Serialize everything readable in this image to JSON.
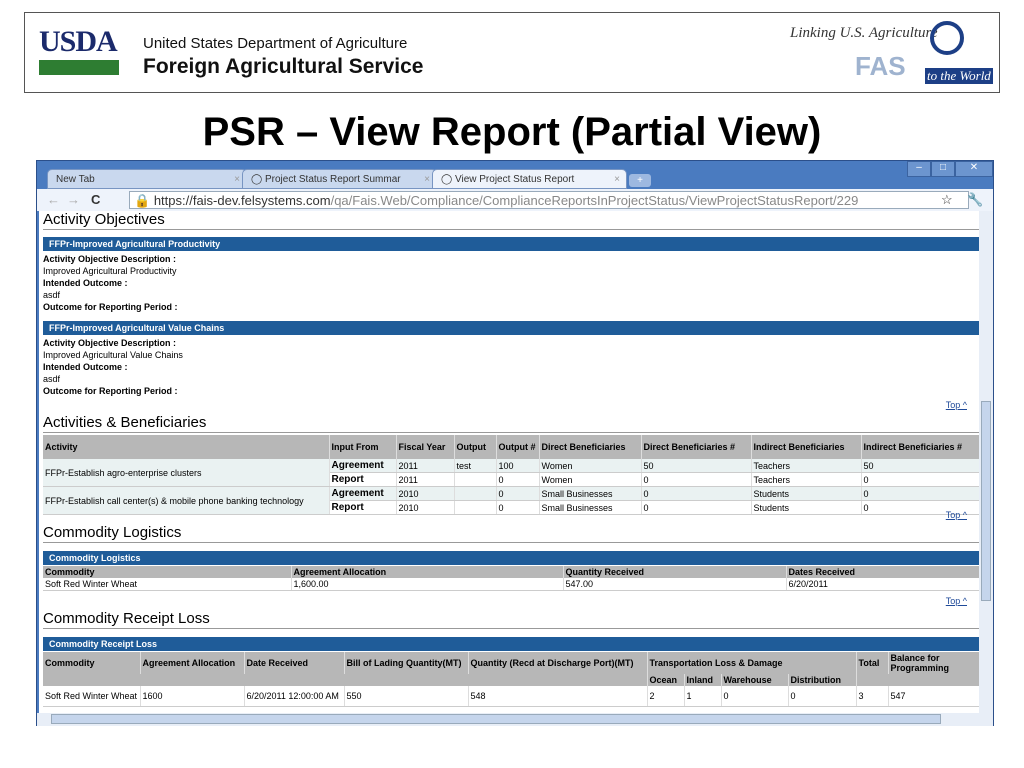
{
  "slide": {
    "logo_left": "USDA",
    "dept": "United States Department of Agriculture",
    "agency": "Foreign Agricultural Service",
    "logo_right_tagline": "Linking U.S. Agriculture",
    "logo_right_fas": "FAS",
    "logo_right_world": "to the World",
    "title": "PSR – View Report (Partial View)"
  },
  "browser": {
    "tabs": [
      {
        "label": "New Tab"
      },
      {
        "label": "Project Status Report Summar"
      },
      {
        "label": "View Project Status Report",
        "active": true
      }
    ],
    "url_host": "https://fais-dev.felsystems.com",
    "url_path": "/qa/Fais.Web/Compliance/ComplianceReportsInProjectStatus/ViewProjectStatusReport/229"
  },
  "page": {
    "top_link": "Top ^",
    "activity_objectives": {
      "heading": "Activity Objectives",
      "items": [
        {
          "title": "FFPr-Improved Agricultural Productivity",
          "desc_label": "Activity Objective Description :",
          "desc": "Improved Agricultural Productivity",
          "outcome_label": "Intended Outcome :",
          "outcome": "asdf",
          "period_label": "Outcome for Reporting Period :"
        },
        {
          "title": "FFPr-Improved Agricultural Value Chains",
          "desc_label": "Activity Objective Description :",
          "desc": "Improved Agricultural Value Chains",
          "outcome_label": "Intended Outcome :",
          "outcome": "asdf",
          "period_label": "Outcome for Reporting Period :"
        }
      ]
    },
    "activities": {
      "heading": "Activities & Beneficiaries",
      "columns": [
        "Activity",
        "Input From",
        "Fiscal Year",
        "Output",
        "Output #",
        "Direct Beneficiaries",
        "Direct Beneficiaries #",
        "Indirect Beneficiaries",
        "Indirect Beneficiaries #"
      ],
      "groups": [
        {
          "activity": "FFPr-Establish agro-enterprise clusters",
          "rows": [
            [
              "Agreement",
              "2011",
              "test",
              "100",
              "Women",
              "50",
              "Teachers",
              "50"
            ],
            [
              "Report",
              "2011",
              "",
              "0",
              "Women",
              "0",
              "Teachers",
              "0"
            ]
          ]
        },
        {
          "activity": "FFPr-Establish call center(s) & mobile phone banking technology",
          "rows": [
            [
              "Agreement",
              "2010",
              "",
              "0",
              "Small Businesses",
              "0",
              "Students",
              "0"
            ],
            [
              "Report",
              "2010",
              "",
              "0",
              "Small Businesses",
              "0",
              "Students",
              "0"
            ]
          ]
        }
      ]
    },
    "logistics": {
      "heading": "Commodity Logistics",
      "bar": "Commodity Logistics",
      "columns": [
        "Commodity",
        "Agreement Allocation",
        "Quantity Received",
        "Dates Received"
      ],
      "rows": [
        [
          "Soft Red Winter Wheat",
          "1,600.00",
          "547.00",
          "6/20/2011"
        ]
      ]
    },
    "receipt_loss": {
      "heading": "Commodity Receipt Loss",
      "bar": "Commodity Receipt Loss",
      "columns": [
        "Commodity",
        "Agreement Allocation",
        "Date Received",
        "Bill of Lading Quantity(MT)",
        "Quantity (Recd at Discharge Port)(MT)",
        "Transportation Loss & Damage",
        "Total",
        "Balance for Programming"
      ],
      "sub_columns": [
        "Ocean",
        "Inland",
        "Warehouse",
        "Distribution"
      ],
      "rows": [
        [
          "Soft Red Winter Wheat",
          "1600",
          "6/20/2011 12:00:00 AM",
          "550",
          "548",
          "2",
          "1",
          "0",
          "0",
          "3",
          "547"
        ]
      ]
    }
  }
}
